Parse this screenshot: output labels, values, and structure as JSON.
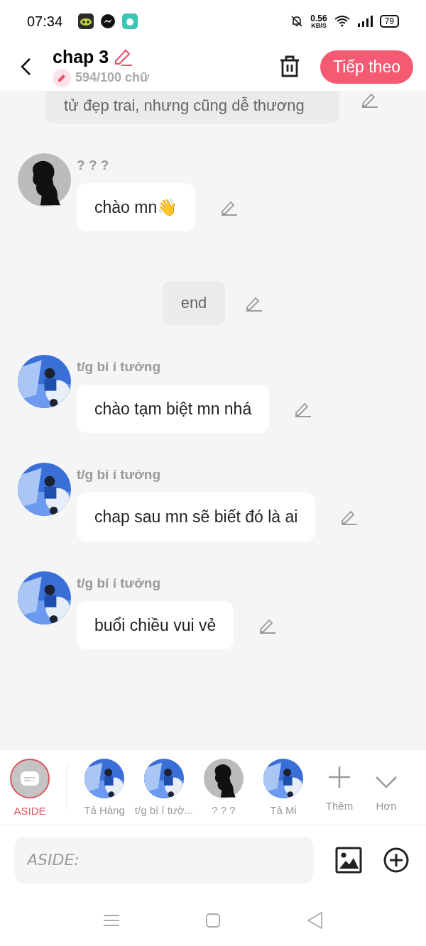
{
  "status_bar": {
    "time": "07:34",
    "speed_value": "0.56",
    "speed_unit": "KB/S",
    "battery": "79"
  },
  "header": {
    "title": "chap 3",
    "word_count": "594/100 chữ",
    "next_button": "Tiếp theo"
  },
  "messages": [
    {
      "kind": "narration",
      "text": "tử đẹp trai, nhưng cũng dễ thương"
    },
    {
      "kind": "character",
      "name": "? ? ?",
      "avatar": {
        "kind": "silhouette"
      },
      "text": "chào mn👋"
    },
    {
      "kind": "narration",
      "text": "end"
    },
    {
      "kind": "character",
      "name": "t/g bí í tưởng",
      "text": "chào tạm biệt mn nhá"
    },
    {
      "kind": "character",
      "name": "t/g bí í tưởng",
      "text": "chap sau mn sẽ biết đó là ai"
    },
    {
      "kind": "character",
      "name": "t/g bí í tưởng",
      "text": "buổi chiều vui vẻ"
    }
  ],
  "characters": [
    {
      "kind": "aside",
      "label": "ASIDE",
      "selected": true
    },
    {
      "kind": "character",
      "label": "Tả Hàng",
      "selected": false
    },
    {
      "kind": "character",
      "label": "t/g bí í tưở...",
      "selected": false
    },
    {
      "kind": "character",
      "label": "? ? ?",
      "avatar": {
        "kind": "silhouette"
      },
      "selected": false
    },
    {
      "kind": "character",
      "label": "Tả Mi",
      "selected": false
    },
    {
      "kind": "add",
      "label": "Thêm"
    },
    {
      "kind": "more",
      "label": "Hơn"
    }
  ],
  "input": {
    "placeholder": "ASIDE:"
  }
}
